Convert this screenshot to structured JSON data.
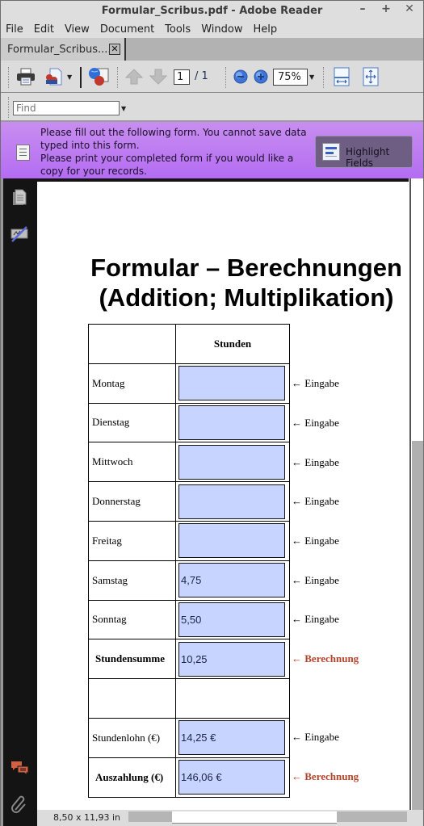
{
  "window": {
    "title": "Formular_Scribus.pdf - Adobe Reader",
    "controls": {
      "minimize": "–",
      "maximize": "+",
      "close": "✕"
    }
  },
  "menubar": {
    "items": [
      "File",
      "Edit",
      "View",
      "Document",
      "Tools",
      "Window",
      "Help"
    ]
  },
  "tabs": [
    {
      "label": "Formular_Scribus....",
      "close": "✕"
    }
  ],
  "toolbar": {
    "icons": [
      "printer-icon",
      "share-icon",
      "web-collaborate-icon",
      "previous-page-icon",
      "next-page-icon",
      "zoom-out-icon",
      "zoom-in-icon",
      "fit-width-icon",
      "fit-page-icon"
    ],
    "page_current": "1",
    "page_total": "/ 1",
    "zoom_level": "75%"
  },
  "findbar": {
    "placeholder": "Find"
  },
  "message_bar": {
    "text_line1": " Please fill out the following form. You cannot save data typed into this form.",
    "text_line2": "Please print your completed form if you would like a copy for your records.",
    "highlight_button": "Highlight Fields",
    "background_color": "#b46cf2"
  },
  "document": {
    "title_line1": "Formular – Berechnungen",
    "title_line2": "(Addition; Multiplikation)",
    "column_header": "Stunden",
    "field_color": "#c6d4ff",
    "calc_color": "#b5432a",
    "rows": [
      {
        "label": "Montag",
        "value": "",
        "note": "← Eingabe",
        "type": "input"
      },
      {
        "label": "Dienstag",
        "value": "",
        "note": "← Eingabe",
        "type": "input"
      },
      {
        "label": "Mittwoch",
        "value": "",
        "note": "← Eingabe",
        "type": "input"
      },
      {
        "label": "Donnerstag",
        "value": "",
        "note": "← Eingabe",
        "type": "input"
      },
      {
        "label": "Freitag",
        "value": "",
        "note": "← Eingabe",
        "type": "input"
      },
      {
        "label": "Samstag",
        "value": "4,75",
        "note": "← Eingabe",
        "type": "input"
      },
      {
        "label": "Sonntag",
        "value": "5,50",
        "note": "← Eingabe",
        "type": "input"
      },
      {
        "label": "Stundensumme",
        "value": "10,25",
        "note": "← Berechnung",
        "type": "calc"
      },
      {
        "label": "",
        "value": "",
        "note": "",
        "type": "empty"
      },
      {
        "label": "Stundenlohn (€)",
        "value": "14,25 €",
        "note": "← Eingabe",
        "type": "input"
      },
      {
        "label": "Auszahlung (€)",
        "value": "146,06 €",
        "note": "← Berechnung",
        "type": "calc"
      }
    ]
  },
  "statusbar": {
    "page_size": "8,50 x 11,93 in"
  }
}
